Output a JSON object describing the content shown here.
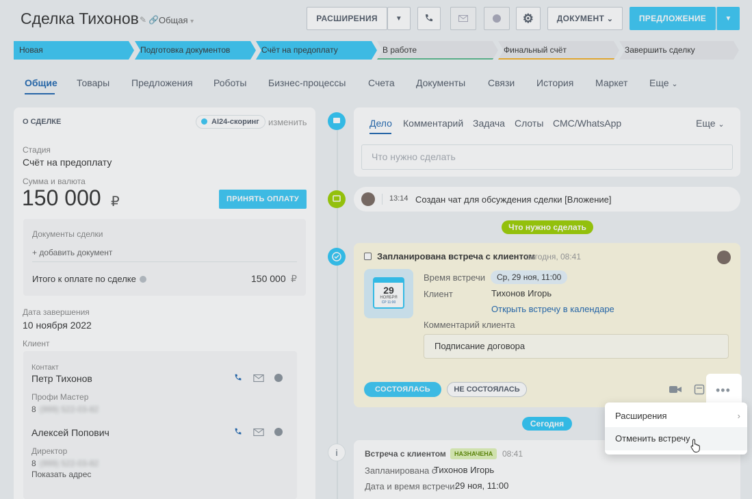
{
  "header": {
    "title": "Сделка Тихонов",
    "category": "Общая",
    "btn_extensions": "РАСШИРЕНИЯ",
    "btn_document": "ДОКУМЕНТ",
    "btn_offer": "ПРЕДЛОЖЕНИЕ"
  },
  "stages": [
    {
      "label": "Новая",
      "color": "#3bc8f5"
    },
    {
      "label": "Подготовка документов",
      "color": "#3bc8f5"
    },
    {
      "label": "Счёт на предоплату",
      "color": "#3bc8f5"
    },
    {
      "label": "В работе",
      "color": "#e6e8eb"
    },
    {
      "label": "Финальный счёт",
      "color": "#e6e8eb"
    },
    {
      "label": "Завершить сделку",
      "color": "#e6e8eb"
    }
  ],
  "tabs": [
    "Общие",
    "Товары",
    "Предложения",
    "Роботы",
    "Бизнес-процессы",
    "Счета",
    "Документы",
    "Связи",
    "История",
    "Маркет",
    "Еще"
  ],
  "left": {
    "section_title": "О СДЕЛКЕ",
    "ai_badge": "AI24-скоринг",
    "edit_link": "изменить",
    "stage_label": "Стадия",
    "stage_value": "Счёт на предоплату",
    "amount_label": "Сумма и валюта",
    "amount_value": "150 000",
    "currency": "₽",
    "accept_payment": "ПРИНЯТЬ ОПЛАТУ",
    "docs_label": "Документы сделки",
    "add_doc": "+ добавить документ",
    "total_label": "Итого к оплате по сделке",
    "total_value": "150 000",
    "end_date_label": "Дата завершения",
    "end_date_value": "10 ноября 2022",
    "client_label": "Клиент",
    "contact_label": "Контакт",
    "contact1_name": "Петр Тихонов",
    "contact1_company": "Профи Мастер",
    "contact1_phone_prefix": "8",
    "contact1_phone_blur": "(999) 522-03-82",
    "contact2_name": "Алексей Попович",
    "contact2_role": "Директор",
    "contact2_phone_prefix": "8",
    "contact2_phone_blur": "(999) 522-03-82",
    "show_address": "Показать адрес"
  },
  "composer": {
    "tabs": [
      "Дело",
      "Комментарий",
      "Задача",
      "Слоты",
      "СМС/WhatsApp"
    ],
    "more": "Еще",
    "placeholder": "Что нужно сделать"
  },
  "timeline": {
    "chat_time": "13:14",
    "chat_text": "Создан чат для обсуждения сделки [Вложение]",
    "todo_pill": "Что нужно сделать",
    "meeting_title": "Запланирована встреча с клиентом",
    "meeting_when": "сегодня, 08:41",
    "cal_day": "29",
    "cal_month": "НОЯБРЯ",
    "cal_time": "СР 11:00",
    "meeting_time_label": "Время встречи",
    "meeting_time_value": "Ср, 29 ноя, 11:00",
    "client_label": "Клиент",
    "client_value": "Тихонов Игорь",
    "open_calendar": "Открыть встречу в календаре",
    "comment_label": "Комментарий клиента",
    "comment_value": "Подписание договора",
    "btn_done": "СОСТОЯЛАСЬ",
    "btn_not_done": "НЕ СОСТОЯЛАСЬ",
    "today_pill": "Сегодня",
    "event_title": "Встреча с клиентом",
    "event_badge": "НАЗНАЧЕНА",
    "event_time": "08:41",
    "event_planned_prefix": "Запланирована с",
    "event_planned_name": "Тихонов Игорь",
    "event_date_label": "Дата и время встречи:",
    "event_date_value": "29 ноя, 11:00"
  },
  "menu": {
    "items": [
      "Расширения",
      "Отменить встречу"
    ]
  },
  "colors": {
    "accent": "#3bc8f5",
    "link": "#2067b0",
    "green": "#9dcf00"
  }
}
